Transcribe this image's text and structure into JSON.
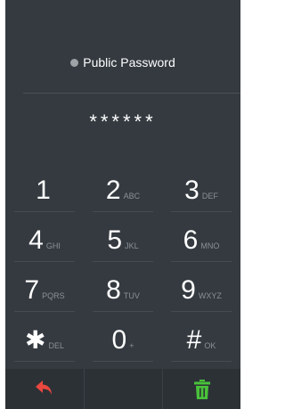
{
  "header": {
    "label": "Public Password"
  },
  "password": {
    "masked": "******"
  },
  "keypad": {
    "keys": [
      {
        "digit": "1",
        "letters": ""
      },
      {
        "digit": "2",
        "letters": "ABC"
      },
      {
        "digit": "3",
        "letters": "DEF"
      },
      {
        "digit": "4",
        "letters": "GHI"
      },
      {
        "digit": "5",
        "letters": "JKL"
      },
      {
        "digit": "6",
        "letters": "MNO"
      },
      {
        "digit": "7",
        "letters": "PQRS"
      },
      {
        "digit": "8",
        "letters": "TUV"
      },
      {
        "digit": "9",
        "letters": "WXYZ"
      },
      {
        "digit": "✱",
        "letters": "DEL"
      },
      {
        "digit": "0",
        "letters": "+"
      },
      {
        "digit": "#",
        "letters": "OK"
      }
    ]
  },
  "bottom_bar": {
    "back_icon": "back-arrow-icon",
    "delete_icon": "trash-icon",
    "back_color": "#e8483f",
    "delete_color": "#49c23a"
  },
  "theme": {
    "background": "#343a40",
    "text": "#ffffff",
    "secondary_text": "#8b9096"
  }
}
